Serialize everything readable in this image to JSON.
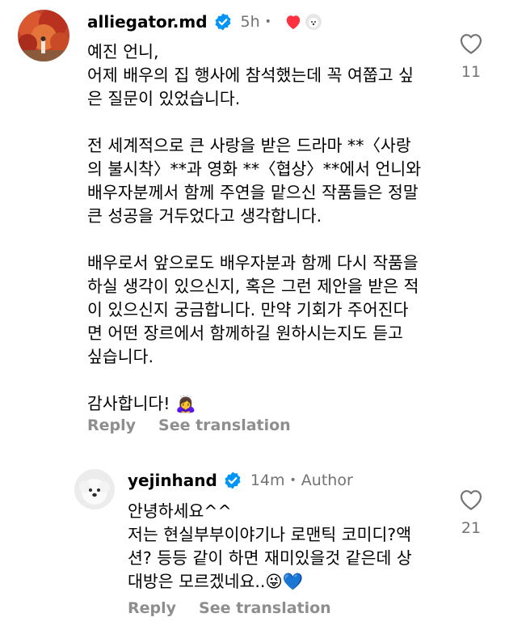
{
  "comments": [
    {
      "username": "alliegator.md",
      "time": "5h",
      "separator": "•",
      "body": "예진 언니,\n어제 배우의 집 행사에 참석했는데 꼭 여쭙고 싶\n은 질문이 있었습니다.\n\n전 세계적으로 큰 사랑을 받은 드라마 **〈사랑\n의 불시착〉**과 영화 **〈협상〉**에서 언니와\n배우자분께서 함께 주연을 맡으신 작품들은 정말\n큰 성공을 거두었다고 생각합니다.\n\n배우로서 앞으로도 배우자분과 함께 다시 작품을\n하실 생각이 있으신지, 혹은 그런 제안을 받은 적\n이 있으신지 궁금합니다. 만약 기회가 주어진다\n면 어떤 장르에서 함께하길 원하시는지도 듣고\n싶습니다.\n\n감사합니다! 🙇‍♀️",
      "reply_label": "Reply",
      "translate_label": "See translation",
      "like_count": "11"
    },
    {
      "username": "yejinhand",
      "time": "14m",
      "separator": "•",
      "badge": "Author",
      "body": "안녕하세요^^\n저는 현실부부이야기나 로맨틱 코미디?액\n션? 등등 같이 하면 재미있을것 같은데 상\n대방은 모르겠네요..😜💙",
      "reply_label": "Reply",
      "translate_label": "See translation",
      "like_count": "21"
    }
  ],
  "colors": {
    "verified": "#0095f6",
    "liked_heart": "#ff3040",
    "muted_text": "#737373",
    "action_text": "#8e8e8e"
  },
  "icons": {
    "verified": "verified-badge-icon",
    "like": "heart-outline-icon",
    "creator_like": "heart-filled-icon"
  }
}
